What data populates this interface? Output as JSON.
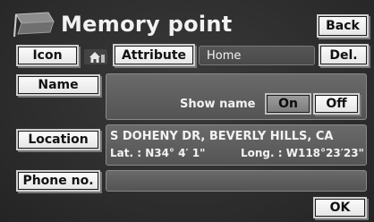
{
  "header": {
    "title": "Memory point",
    "back_label": "Back",
    "icon_name": "memory-point-flag-icon"
  },
  "row1": {
    "icon_label": "Icon",
    "icon_preview_name": "home-icon",
    "attribute_label": "Attribute",
    "attribute_value": "Home",
    "delete_label": "Del."
  },
  "name_row": {
    "name_label": "Name",
    "name_value": "",
    "show_name_label": "Show name",
    "on_label": "On",
    "off_label": "Off",
    "selected": "On"
  },
  "location_row": {
    "location_label": "Location",
    "address": "S DOHENY DR, BEVERLY HILLS, CA",
    "lat": "Lat. : N34° 4′ 1\"",
    "long": "Long. : W118°23′23\""
  },
  "phone_row": {
    "phone_label": "Phone no.",
    "phone_value": ""
  },
  "footer": {
    "ok_label": "OK"
  }
}
